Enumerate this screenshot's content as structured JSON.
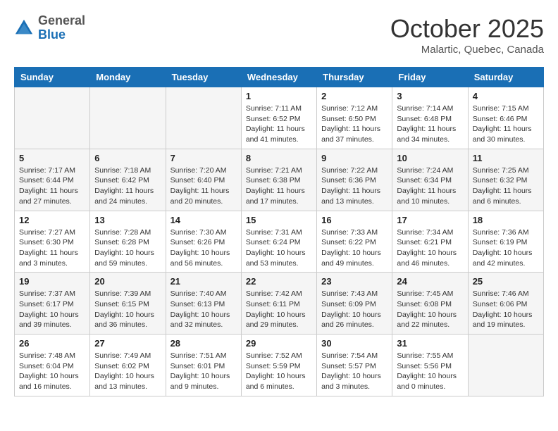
{
  "header": {
    "logo_general": "General",
    "logo_blue": "Blue",
    "month_title": "October 2025",
    "location": "Malartic, Quebec, Canada"
  },
  "weekdays": [
    "Sunday",
    "Monday",
    "Tuesday",
    "Wednesday",
    "Thursday",
    "Friday",
    "Saturday"
  ],
  "weeks": [
    [
      {
        "day": "",
        "sunrise": "",
        "sunset": "",
        "daylight": ""
      },
      {
        "day": "",
        "sunrise": "",
        "sunset": "",
        "daylight": ""
      },
      {
        "day": "",
        "sunrise": "",
        "sunset": "",
        "daylight": ""
      },
      {
        "day": "1",
        "sunrise": "Sunrise: 7:11 AM",
        "sunset": "Sunset: 6:52 PM",
        "daylight": "Daylight: 11 hours and 41 minutes."
      },
      {
        "day": "2",
        "sunrise": "Sunrise: 7:12 AM",
        "sunset": "Sunset: 6:50 PM",
        "daylight": "Daylight: 11 hours and 37 minutes."
      },
      {
        "day": "3",
        "sunrise": "Sunrise: 7:14 AM",
        "sunset": "Sunset: 6:48 PM",
        "daylight": "Daylight: 11 hours and 34 minutes."
      },
      {
        "day": "4",
        "sunrise": "Sunrise: 7:15 AM",
        "sunset": "Sunset: 6:46 PM",
        "daylight": "Daylight: 11 hours and 30 minutes."
      }
    ],
    [
      {
        "day": "5",
        "sunrise": "Sunrise: 7:17 AM",
        "sunset": "Sunset: 6:44 PM",
        "daylight": "Daylight: 11 hours and 27 minutes."
      },
      {
        "day": "6",
        "sunrise": "Sunrise: 7:18 AM",
        "sunset": "Sunset: 6:42 PM",
        "daylight": "Daylight: 11 hours and 24 minutes."
      },
      {
        "day": "7",
        "sunrise": "Sunrise: 7:20 AM",
        "sunset": "Sunset: 6:40 PM",
        "daylight": "Daylight: 11 hours and 20 minutes."
      },
      {
        "day": "8",
        "sunrise": "Sunrise: 7:21 AM",
        "sunset": "Sunset: 6:38 PM",
        "daylight": "Daylight: 11 hours and 17 minutes."
      },
      {
        "day": "9",
        "sunrise": "Sunrise: 7:22 AM",
        "sunset": "Sunset: 6:36 PM",
        "daylight": "Daylight: 11 hours and 13 minutes."
      },
      {
        "day": "10",
        "sunrise": "Sunrise: 7:24 AM",
        "sunset": "Sunset: 6:34 PM",
        "daylight": "Daylight: 11 hours and 10 minutes."
      },
      {
        "day": "11",
        "sunrise": "Sunrise: 7:25 AM",
        "sunset": "Sunset: 6:32 PM",
        "daylight": "Daylight: 11 hours and 6 minutes."
      }
    ],
    [
      {
        "day": "12",
        "sunrise": "Sunrise: 7:27 AM",
        "sunset": "Sunset: 6:30 PM",
        "daylight": "Daylight: 11 hours and 3 minutes."
      },
      {
        "day": "13",
        "sunrise": "Sunrise: 7:28 AM",
        "sunset": "Sunset: 6:28 PM",
        "daylight": "Daylight: 10 hours and 59 minutes."
      },
      {
        "day": "14",
        "sunrise": "Sunrise: 7:30 AM",
        "sunset": "Sunset: 6:26 PM",
        "daylight": "Daylight: 10 hours and 56 minutes."
      },
      {
        "day": "15",
        "sunrise": "Sunrise: 7:31 AM",
        "sunset": "Sunset: 6:24 PM",
        "daylight": "Daylight: 10 hours and 53 minutes."
      },
      {
        "day": "16",
        "sunrise": "Sunrise: 7:33 AM",
        "sunset": "Sunset: 6:22 PM",
        "daylight": "Daylight: 10 hours and 49 minutes."
      },
      {
        "day": "17",
        "sunrise": "Sunrise: 7:34 AM",
        "sunset": "Sunset: 6:21 PM",
        "daylight": "Daylight: 10 hours and 46 minutes."
      },
      {
        "day": "18",
        "sunrise": "Sunrise: 7:36 AM",
        "sunset": "Sunset: 6:19 PM",
        "daylight": "Daylight: 10 hours and 42 minutes."
      }
    ],
    [
      {
        "day": "19",
        "sunrise": "Sunrise: 7:37 AM",
        "sunset": "Sunset: 6:17 PM",
        "daylight": "Daylight: 10 hours and 39 minutes."
      },
      {
        "day": "20",
        "sunrise": "Sunrise: 7:39 AM",
        "sunset": "Sunset: 6:15 PM",
        "daylight": "Daylight: 10 hours and 36 minutes."
      },
      {
        "day": "21",
        "sunrise": "Sunrise: 7:40 AM",
        "sunset": "Sunset: 6:13 PM",
        "daylight": "Daylight: 10 hours and 32 minutes."
      },
      {
        "day": "22",
        "sunrise": "Sunrise: 7:42 AM",
        "sunset": "Sunset: 6:11 PM",
        "daylight": "Daylight: 10 hours and 29 minutes."
      },
      {
        "day": "23",
        "sunrise": "Sunrise: 7:43 AM",
        "sunset": "Sunset: 6:09 PM",
        "daylight": "Daylight: 10 hours and 26 minutes."
      },
      {
        "day": "24",
        "sunrise": "Sunrise: 7:45 AM",
        "sunset": "Sunset: 6:08 PM",
        "daylight": "Daylight: 10 hours and 22 minutes."
      },
      {
        "day": "25",
        "sunrise": "Sunrise: 7:46 AM",
        "sunset": "Sunset: 6:06 PM",
        "daylight": "Daylight: 10 hours and 19 minutes."
      }
    ],
    [
      {
        "day": "26",
        "sunrise": "Sunrise: 7:48 AM",
        "sunset": "Sunset: 6:04 PM",
        "daylight": "Daylight: 10 hours and 16 minutes."
      },
      {
        "day": "27",
        "sunrise": "Sunrise: 7:49 AM",
        "sunset": "Sunset: 6:02 PM",
        "daylight": "Daylight: 10 hours and 13 minutes."
      },
      {
        "day": "28",
        "sunrise": "Sunrise: 7:51 AM",
        "sunset": "Sunset: 6:01 PM",
        "daylight": "Daylight: 10 hours and 9 minutes."
      },
      {
        "day": "29",
        "sunrise": "Sunrise: 7:52 AM",
        "sunset": "Sunset: 5:59 PM",
        "daylight": "Daylight: 10 hours and 6 minutes."
      },
      {
        "day": "30",
        "sunrise": "Sunrise: 7:54 AM",
        "sunset": "Sunset: 5:57 PM",
        "daylight": "Daylight: 10 hours and 3 minutes."
      },
      {
        "day": "31",
        "sunrise": "Sunrise: 7:55 AM",
        "sunset": "Sunset: 5:56 PM",
        "daylight": "Daylight: 10 hours and 0 minutes."
      },
      {
        "day": "",
        "sunrise": "",
        "sunset": "",
        "daylight": ""
      }
    ]
  ]
}
